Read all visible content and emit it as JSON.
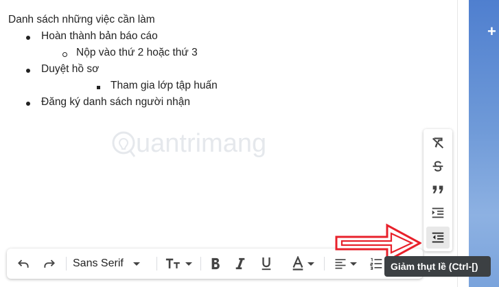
{
  "compose": {
    "heading": "Danh sách những việc cần làm",
    "items": [
      {
        "text": "Hoàn thành bản báo cáo",
        "level": 1
      },
      {
        "text": "Nộp vào thứ 2 hoặc thứ 3",
        "level": 2
      },
      {
        "text": "Duyệt hồ sơ",
        "level": 1
      },
      {
        "text": "Tham gia lớp tập huấn",
        "level": 3
      },
      {
        "text": "Đăng ký danh sách người nhận",
        "level": 1
      }
    ]
  },
  "watermark": {
    "text": "uantrimang"
  },
  "format_panel": {
    "buttons": [
      {
        "icon": "clear-formatting-icon"
      },
      {
        "icon": "strikethrough-icon"
      },
      {
        "icon": "quote-icon"
      },
      {
        "icon": "indent-more-icon"
      },
      {
        "icon": "indent-less-icon",
        "active": true
      }
    ]
  },
  "toolbar": {
    "font_family": "Sans Serif",
    "buttons": [
      "undo-icon",
      "redo-icon",
      "font-size-icon",
      "bold-icon",
      "italic-icon",
      "underline-icon",
      "text-color-icon",
      "align-icon",
      "numbered-list-icon"
    ]
  },
  "tooltip": {
    "text": "Giảm thụt lề (Ctrl-[)"
  },
  "colors": {
    "arrow": "#e8212b",
    "side_panel": "#6f9ad8",
    "tooltip_bg": "#3c4043"
  }
}
